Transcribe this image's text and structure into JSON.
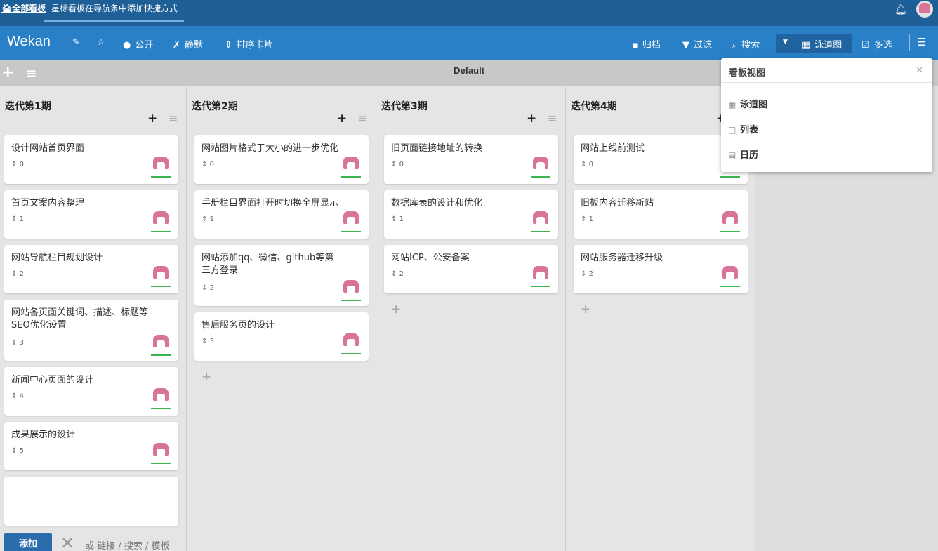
{
  "topbar": {
    "home_label": "全部看板",
    "hint": "星标看板在导航条中添加快捷方式",
    "bell_icon": "bell-icon",
    "home_icon": "home-icon"
  },
  "header": {
    "brand": "Wekan",
    "public_label": "公开",
    "mute_label": "静默",
    "sort_label": "排序卡片",
    "archive_label": "归档",
    "filter_label": "过滤",
    "search_label": "搜索",
    "view_label": "泳道图",
    "multiselect_label": "多选"
  },
  "swimlane": {
    "title": "Default"
  },
  "lists": [
    {
      "title": "迭代第1期",
      "cards": [
        {
          "title": "设计网站首页界面",
          "sort": "0"
        },
        {
          "title": "首页文案内容整理",
          "sort": "1"
        },
        {
          "title": "网站导航栏目规划设计",
          "sort": "2"
        },
        {
          "title": "网站各页面关键词、描述、标题等SEO优化设置",
          "sort": "3"
        },
        {
          "title": "新闻中心页面的设计",
          "sort": "4"
        },
        {
          "title": "成果展示的设计",
          "sort": "5"
        }
      ]
    },
    {
      "title": "迭代第2期",
      "cards": [
        {
          "title": "网站图片格式于大小的进一步优化",
          "sort": "0"
        },
        {
          "title": "手册栏目界面打开时切换全屏显示",
          "sort": "1"
        },
        {
          "title": "网站添加qq、微信、github等第三方登录",
          "sort": "2"
        },
        {
          "title": "售后服务页的设计",
          "sort": "3"
        }
      ]
    },
    {
      "title": "迭代第3期",
      "cards": [
        {
          "title": "旧页面链接地址的转换",
          "sort": "0"
        },
        {
          "title": "数据库表的设计和优化",
          "sort": "1"
        },
        {
          "title": "网站ICP、公安备案",
          "sort": "2"
        }
      ]
    },
    {
      "title": "迭代第4期",
      "cards": [
        {
          "title": "网站上线前测试",
          "sort": "0"
        },
        {
          "title": "旧板内容迁移新站",
          "sort": "1"
        },
        {
          "title": "网站服务器迁移升级",
          "sort": "2"
        }
      ]
    }
  ],
  "composer": {
    "add_label": "添加",
    "or_label": "或",
    "link_label": "链接",
    "search_label": "搜索",
    "template_label": "模板",
    "sep": "/"
  },
  "popup": {
    "title": "看板视图",
    "close": "×",
    "items": [
      "泳道图",
      "列表",
      "日历"
    ]
  },
  "colors": {
    "topbar": "#1f5f97",
    "header": "#2980c6",
    "avatar": "#d9739a",
    "card_line": "#3cb550",
    "add_button": "#2b6cad"
  }
}
